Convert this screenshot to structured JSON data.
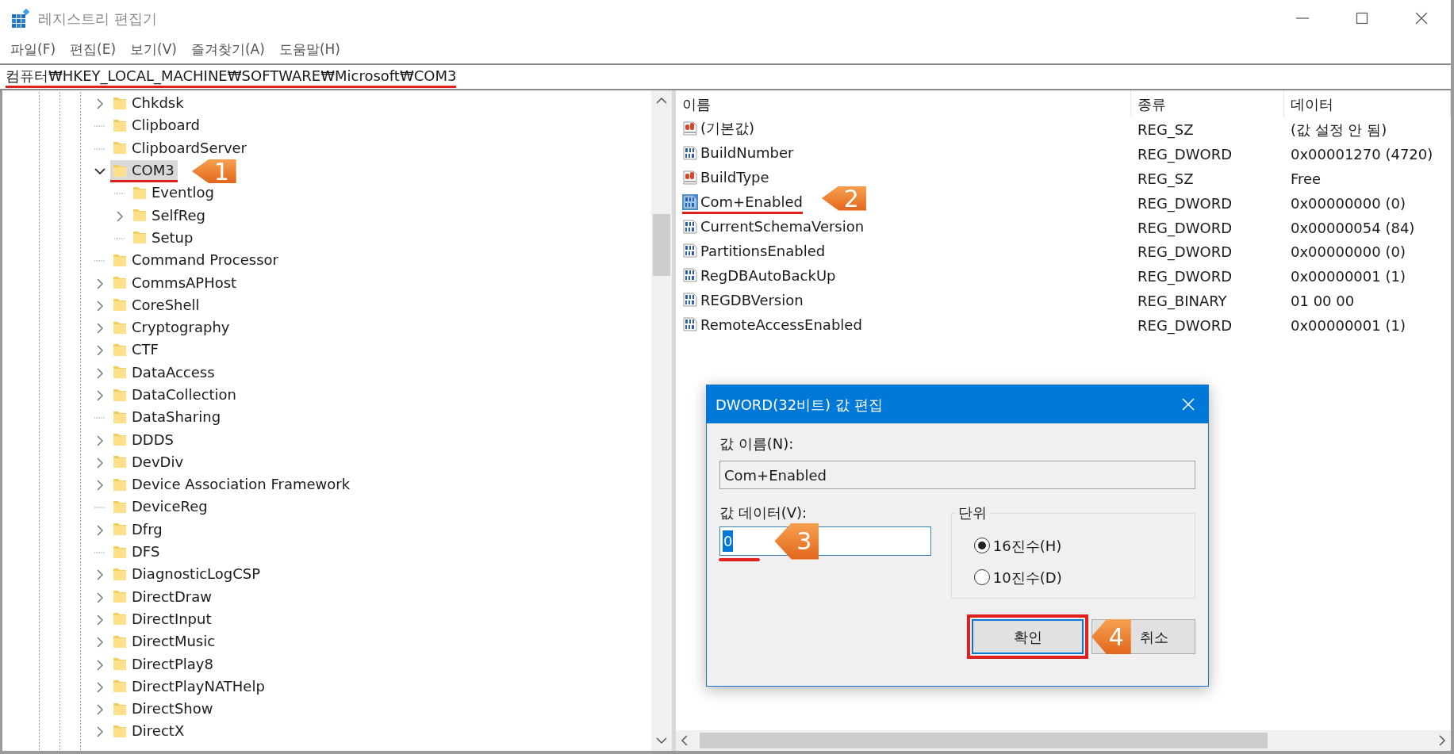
{
  "window": {
    "title": "레지스트리 편집기"
  },
  "menu": [
    "파일(F)",
    "편집(E)",
    "보기(V)",
    "즐겨찾기(A)",
    "도움말(H)"
  ],
  "address": {
    "path": "컴퓨터₩HKEY_LOCAL_MACHINE₩SOFTWARE₩Microsoft₩COM3",
    "underlined": true
  },
  "tree": {
    "items": [
      {
        "label": "Chkdsk",
        "kind": "branch",
        "selected": false
      },
      {
        "label": "Clipboard",
        "kind": "leaf",
        "selected": false
      },
      {
        "label": "ClipboardServer",
        "kind": "leaf",
        "selected": false
      },
      {
        "label": "COM3",
        "kind": "expanded",
        "selected": true,
        "callout": "1",
        "children": [
          {
            "label": "Eventlog",
            "kind": "leaf",
            "selected": false
          },
          {
            "label": "SelfReg",
            "kind": "branch",
            "selected": false
          },
          {
            "label": "Setup",
            "kind": "leaf",
            "selected": false
          }
        ]
      },
      {
        "label": "Command Processor",
        "kind": "leaf",
        "selected": false
      },
      {
        "label": "CommsAPHost",
        "kind": "branch",
        "selected": false
      },
      {
        "label": "CoreShell",
        "kind": "branch",
        "selected": false
      },
      {
        "label": "Cryptography",
        "kind": "branch",
        "selected": false
      },
      {
        "label": "CTF",
        "kind": "branch",
        "selected": false
      },
      {
        "label": "DataAccess",
        "kind": "branch",
        "selected": false
      },
      {
        "label": "DataCollection",
        "kind": "branch",
        "selected": false
      },
      {
        "label": "DataSharing",
        "kind": "leaf",
        "selected": false
      },
      {
        "label": "DDDS",
        "kind": "branch",
        "selected": false
      },
      {
        "label": "DevDiv",
        "kind": "branch",
        "selected": false
      },
      {
        "label": "Device Association Framework",
        "kind": "branch",
        "selected": false
      },
      {
        "label": "DeviceReg",
        "kind": "leaf",
        "selected": false
      },
      {
        "label": "Dfrg",
        "kind": "branch",
        "selected": false
      },
      {
        "label": "DFS",
        "kind": "leaf",
        "selected": false
      },
      {
        "label": "DiagnosticLogCSP",
        "kind": "branch",
        "selected": false
      },
      {
        "label": "DirectDraw",
        "kind": "branch",
        "selected": false
      },
      {
        "label": "DirectInput",
        "kind": "branch",
        "selected": false
      },
      {
        "label": "DirectMusic",
        "kind": "branch",
        "selected": false
      },
      {
        "label": "DirectPlay8",
        "kind": "branch",
        "selected": false
      },
      {
        "label": "DirectPlayNATHelp",
        "kind": "branch",
        "selected": false
      },
      {
        "label": "DirectShow",
        "kind": "branch",
        "selected": false
      },
      {
        "label": "DirectX",
        "kind": "branch",
        "selected": false
      }
    ]
  },
  "values": {
    "columns": [
      "이름",
      "종류",
      "데이터"
    ],
    "rows": [
      {
        "kind": "string",
        "name": "(기본값)",
        "type": "REG_SZ",
        "data": "(값 설정 안 됨)",
        "selected": false
      },
      {
        "kind": "number",
        "name": "BuildNumber",
        "type": "REG_DWORD",
        "data": "0x00001270 (4720)",
        "selected": false
      },
      {
        "kind": "string",
        "name": "BuildType",
        "type": "REG_SZ",
        "data": "Free",
        "selected": false
      },
      {
        "kind": "number",
        "name": "Com+Enabled",
        "type": "REG_DWORD",
        "data": "0x00000000 (0)",
        "selected": true,
        "callout": "2"
      },
      {
        "kind": "number",
        "name": "CurrentSchemaVersion",
        "type": "REG_DWORD",
        "data": "0x00000054 (84)",
        "selected": false
      },
      {
        "kind": "number",
        "name": "PartitionsEnabled",
        "type": "REG_DWORD",
        "data": "0x00000000 (0)",
        "selected": false
      },
      {
        "kind": "number",
        "name": "RegDBAutoBackUp",
        "type": "REG_DWORD",
        "data": "0x00000001 (1)",
        "selected": false
      },
      {
        "kind": "number",
        "name": "REGDBVersion",
        "type": "REG_BINARY",
        "data": "01 00 00",
        "selected": false
      },
      {
        "kind": "number",
        "name": "RemoteAccessEnabled",
        "type": "REG_DWORD",
        "data": "0x00000001 (1)",
        "selected": false
      }
    ]
  },
  "dialog": {
    "title": "DWORD(32비트) 값 편집",
    "name_label": "값 이름(N):",
    "name_value": "Com+Enabled",
    "data_label": "값 데이터(V):",
    "data_value": "0",
    "data_callout": "3",
    "base_label": "단위",
    "bases": [
      {
        "label": "16진수(H)",
        "selected": true
      },
      {
        "label": "10진수(D)",
        "selected": false
      }
    ],
    "buttons": [
      {
        "label": "확인",
        "kind": "ok",
        "framed": true,
        "callout": "4"
      },
      {
        "label": "취소",
        "kind": "cancel",
        "framed": false
      }
    ]
  }
}
